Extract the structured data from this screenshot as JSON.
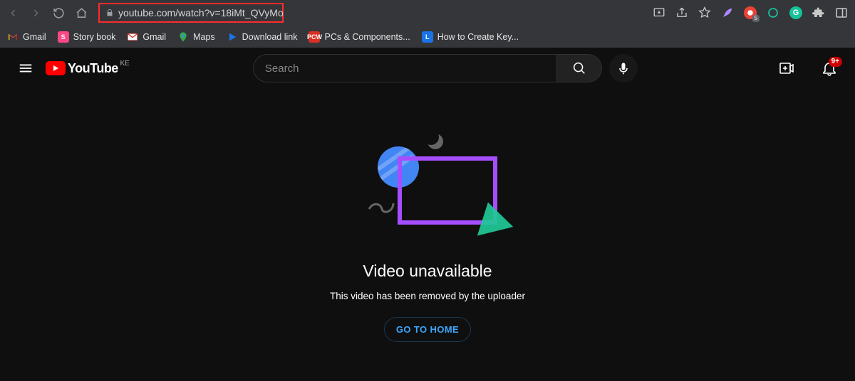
{
  "browser": {
    "url": "youtube.com/watch?v=18iMt_QVyMo",
    "ext_badge": "5"
  },
  "bookmarks": [
    {
      "label": "Gmail",
      "iconColor": "#ffffff",
      "iconText": "M",
      "iconStyle": "gmail-new"
    },
    {
      "label": "Story book",
      "iconColor": "#ff4785",
      "iconText": "S",
      "iconStyle": "box"
    },
    {
      "label": "Gmail",
      "iconColor": "#ffffff",
      "iconText": "M",
      "iconStyle": "gmail-old"
    },
    {
      "label": "Maps",
      "iconColor": "#34a853",
      "iconText": "",
      "iconStyle": "maps-pin"
    },
    {
      "label": "Download link",
      "iconColor": "#1a73e8",
      "iconText": "▶",
      "iconStyle": "play"
    },
    {
      "label": "PCs & Components...",
      "iconColor": "#d93025",
      "iconText": "PCW",
      "iconStyle": "box"
    },
    {
      "label": "How to Create Key...",
      "iconColor": "#1a73e8",
      "iconText": "L",
      "iconStyle": "box"
    }
  ],
  "youtube": {
    "logoText": "YouTube",
    "countryCode": "KE",
    "searchPlaceholder": "Search",
    "notifBadge": "9+"
  },
  "error": {
    "title": "Video unavailable",
    "subtitle": "This video has been removed by the uploader",
    "button": "GO TO HOME"
  }
}
